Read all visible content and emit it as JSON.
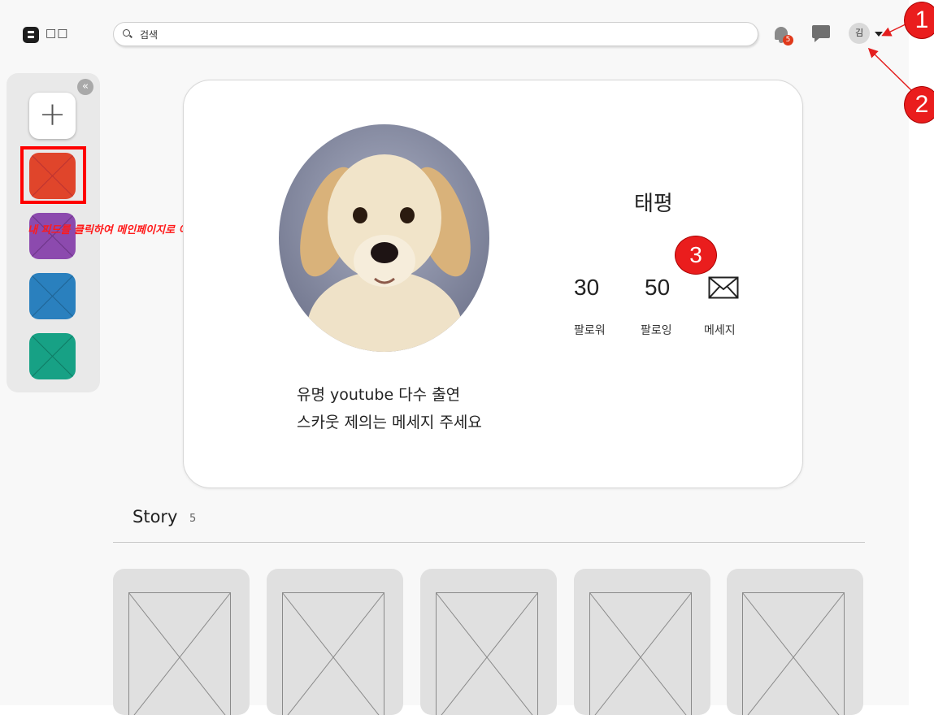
{
  "header": {
    "logo_text": "□□",
    "search_placeholder": "검색",
    "notification_count": "5",
    "avatar_text": "김"
  },
  "callouts": {
    "one": "1",
    "two": "2",
    "three": "3"
  },
  "sidebar": {
    "collapse_glyph": "«",
    "add_glyph": "+",
    "feeds": [
      {
        "color": "#e0452b"
      },
      {
        "color": "#8c4aae"
      },
      {
        "color": "#2a80be"
      },
      {
        "color": "#17a185"
      }
    ],
    "annotation": "내 피드를 클릭하여 메인페이지로 이동!"
  },
  "profile": {
    "name": "태평",
    "followers_count": "30",
    "followers_label": "팔로워",
    "following_count": "50",
    "following_label": "팔로잉",
    "message_label": "메세지",
    "bio_line1": "유명 youtube 다수 출연",
    "bio_line2": "스카웃 제의는 메세지 주세요"
  },
  "story": {
    "title": "Story",
    "count": "5"
  },
  "colors": {
    "accent_red": "#ff0000",
    "badge": "#e0391b",
    "card_placeholder": "#e0e0e0"
  }
}
